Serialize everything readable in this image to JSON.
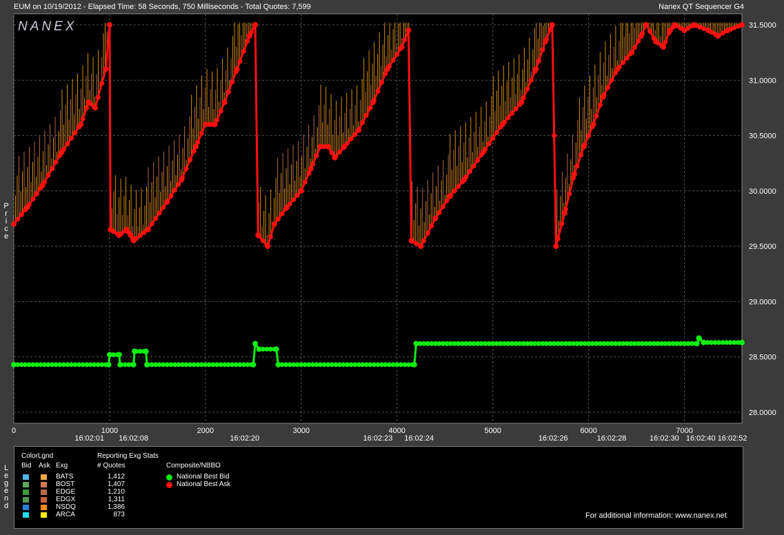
{
  "window": {
    "left_title": "EUM on 10/19/2012  -  Elapsed Time: 58 Seconds, 750 Milliseconds  -  Total Quotes: 7,599",
    "right_title": "Nanex QT Sequencer G4",
    "logo": "NANEX",
    "price_label": [
      "P",
      "r",
      "i",
      "c",
      "e"
    ],
    "legend_label": [
      "L",
      "e",
      "g",
      "e",
      "n",
      "d"
    ]
  },
  "chart_data": {
    "type": "line",
    "x": {
      "range": [
        0,
        7600
      ],
      "ticks": [
        0,
        1000,
        2000,
        3000,
        4000,
        5000,
        6000,
        7000
      ]
    },
    "y": {
      "range": [
        27.9,
        31.6
      ],
      "ticks": [
        28.0,
        28.5,
        29.0,
        29.5,
        30.0,
        30.5,
        31.0,
        31.5
      ],
      "tick_labels": [
        "28.0000",
        "28.5000",
        "29.0000",
        "29.5000",
        "30.0000",
        "30.5000",
        "31.0000",
        "31.5000"
      ]
    },
    "time_labels": [
      {
        "x": 790,
        "text": "16:02:01"
      },
      {
        "x": 1250,
        "text": "16:02:08"
      },
      {
        "x": 2410,
        "text": "16:02:20"
      },
      {
        "x": 3800,
        "text": "16:02:23"
      },
      {
        "x": 4230,
        "text": "16:02:24"
      },
      {
        "x": 5630,
        "text": "16:02:26"
      },
      {
        "x": 6240,
        "text": "16:02:28"
      },
      {
        "x": 6790,
        "text": "16:02:30"
      },
      {
        "x": 7170,
        "text": "16:02:40"
      },
      {
        "x": 7500,
        "text": "16:02:52"
      }
    ],
    "grid": true,
    "series": [
      {
        "name": "National Best Ask",
        "color": "#ff1010",
        "points": [
          [
            0,
            29.7
          ],
          [
            140,
            29.85
          ],
          [
            300,
            30.05
          ],
          [
            500,
            30.35
          ],
          [
            700,
            30.6
          ],
          [
            780,
            30.8
          ],
          [
            850,
            30.75
          ],
          [
            960,
            31.1
          ],
          [
            1000,
            31.5
          ],
          [
            1010,
            29.65
          ],
          [
            1100,
            29.6
          ],
          [
            1180,
            29.65
          ],
          [
            1220,
            29.6
          ],
          [
            1250,
            29.55
          ],
          [
            1400,
            29.65
          ],
          [
            1600,
            29.9
          ],
          [
            1750,
            30.1
          ],
          [
            1900,
            30.4
          ],
          [
            2000,
            30.6
          ],
          [
            2100,
            30.6
          ],
          [
            2200,
            30.8
          ],
          [
            2330,
            31.1
          ],
          [
            2460,
            31.4
          ],
          [
            2520,
            31.5
          ],
          [
            2550,
            29.6
          ],
          [
            2650,
            29.5
          ],
          [
            2720,
            29.7
          ],
          [
            2850,
            29.85
          ],
          [
            3000,
            30.0
          ],
          [
            3100,
            30.2
          ],
          [
            3200,
            30.4
          ],
          [
            3280,
            30.4
          ],
          [
            3350,
            30.3
          ],
          [
            3450,
            30.4
          ],
          [
            3600,
            30.55
          ],
          [
            3750,
            30.8
          ],
          [
            3900,
            31.1
          ],
          [
            4050,
            31.3
          ],
          [
            4120,
            31.45
          ],
          [
            4150,
            29.55
          ],
          [
            4250,
            29.5
          ],
          [
            4400,
            29.75
          ],
          [
            4550,
            29.95
          ],
          [
            4700,
            30.1
          ],
          [
            4900,
            30.35
          ],
          [
            5100,
            30.6
          ],
          [
            5300,
            30.8
          ],
          [
            5450,
            31.1
          ],
          [
            5550,
            31.35
          ],
          [
            5620,
            31.5
          ],
          [
            5660,
            29.5
          ],
          [
            5750,
            29.8
          ],
          [
            5850,
            30.15
          ],
          [
            5950,
            30.4
          ],
          [
            6050,
            30.6
          ],
          [
            6150,
            30.85
          ],
          [
            6300,
            31.1
          ],
          [
            6450,
            31.25
          ],
          [
            6550,
            31.4
          ],
          [
            6600,
            31.5
          ],
          [
            6700,
            31.35
          ],
          [
            6780,
            31.3
          ],
          [
            6850,
            31.45
          ],
          [
            6900,
            31.5
          ],
          [
            7000,
            31.45
          ],
          [
            7100,
            31.5
          ],
          [
            7250,
            31.45
          ],
          [
            7350,
            31.4
          ],
          [
            7450,
            31.45
          ],
          [
            7600,
            31.5
          ]
        ]
      },
      {
        "name": "National Best Bid",
        "color": "#10ee10",
        "points": [
          [
            0,
            28.43
          ],
          [
            990,
            28.43
          ],
          [
            1000,
            28.52
          ],
          [
            1100,
            28.52
          ],
          [
            1110,
            28.43
          ],
          [
            1250,
            28.43
          ],
          [
            1260,
            28.55
          ],
          [
            1380,
            28.55
          ],
          [
            1390,
            28.43
          ],
          [
            2500,
            28.43
          ],
          [
            2520,
            28.62
          ],
          [
            2560,
            28.57
          ],
          [
            2740,
            28.57
          ],
          [
            2760,
            28.43
          ],
          [
            4180,
            28.43
          ],
          [
            4200,
            28.62
          ],
          [
            7130,
            28.62
          ],
          [
            7150,
            28.67
          ],
          [
            7200,
            28.63
          ],
          [
            7600,
            28.63
          ]
        ]
      }
    ],
    "fill_color": "#ffaa00"
  },
  "legend": {
    "color_lgnd": "ColorLgnd",
    "col_bid": "Bid",
    "col_ask": "Ask",
    "col_exg": "Exg",
    "stats_title": "Reporting Exg Stats",
    "col_quotes": "# Quotes",
    "composite_title": "Composite/NBBO",
    "rows": [
      {
        "exg": "BATS",
        "quotes": "1,412",
        "bid_color": "#4fb4e8",
        "ask_color": "#f0a848"
      },
      {
        "exg": "BOST",
        "quotes": "1,407",
        "bid_color": "#5aa85a",
        "ask_color": "#d07858"
      },
      {
        "exg": "EDGE",
        "quotes": "1,210",
        "bid_color": "#3c9c3c",
        "ask_color": "#b86848"
      },
      {
        "exg": "EDGX",
        "quotes": "1,311",
        "bid_color": "#509850",
        "ask_color": "#c86040"
      },
      {
        "exg": "NSDQ",
        "quotes": "1,386",
        "bid_color": "#2a80d8",
        "ask_color": "#ff8c10"
      },
      {
        "exg": "ARCA",
        "quotes": "873",
        "bid_color": "#20e0f0",
        "ask_color": "#f8f010"
      }
    ],
    "nbbo": [
      {
        "label": "National Best Bid",
        "color": "#10ee10"
      },
      {
        "label": "National Best Ask",
        "color": "#ff1010"
      }
    ],
    "footer": "For additional information: www.nanex.net"
  }
}
